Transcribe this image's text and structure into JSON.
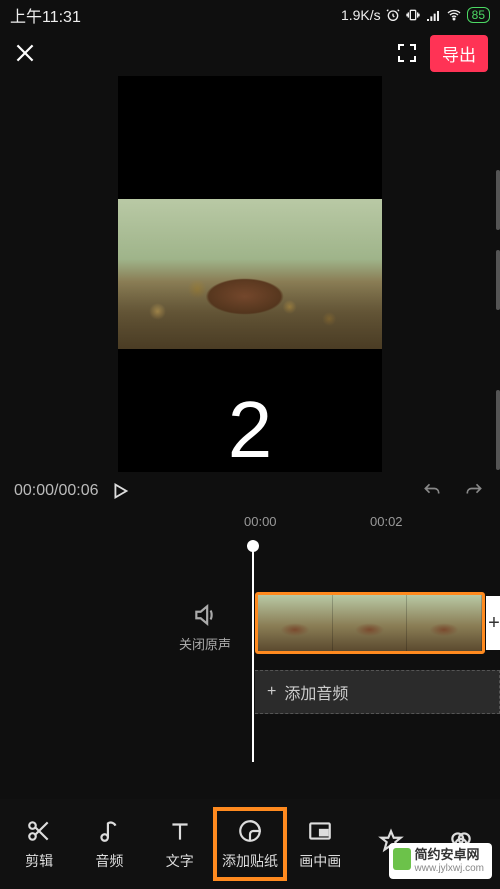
{
  "status": {
    "time": "上午11:31",
    "net_speed": "1.9K/s",
    "battery": "85"
  },
  "topbar": {
    "export_label": "导出"
  },
  "preview": {
    "overlay_number": "2"
  },
  "playback": {
    "current": "00:00",
    "total": "00:06",
    "timecode": "00:00/00:06"
  },
  "ruler": {
    "ticks": [
      "00:00",
      "00:02"
    ]
  },
  "timeline": {
    "mute_label": "关闭原声",
    "add_audio_label": "添加音频"
  },
  "toolbar": {
    "items": [
      {
        "id": "edit",
        "label": "剪辑"
      },
      {
        "id": "audio",
        "label": "音频"
      },
      {
        "id": "text",
        "label": "文字"
      },
      {
        "id": "sticker",
        "label": "添加贴纸",
        "highlight": true
      },
      {
        "id": "pip",
        "label": "画中画"
      },
      {
        "id": "effect",
        "label": ""
      },
      {
        "id": "filter",
        "label": ""
      }
    ]
  },
  "watermark": {
    "line1": "简约安卓网",
    "line2": "www.jylxwj.com"
  }
}
